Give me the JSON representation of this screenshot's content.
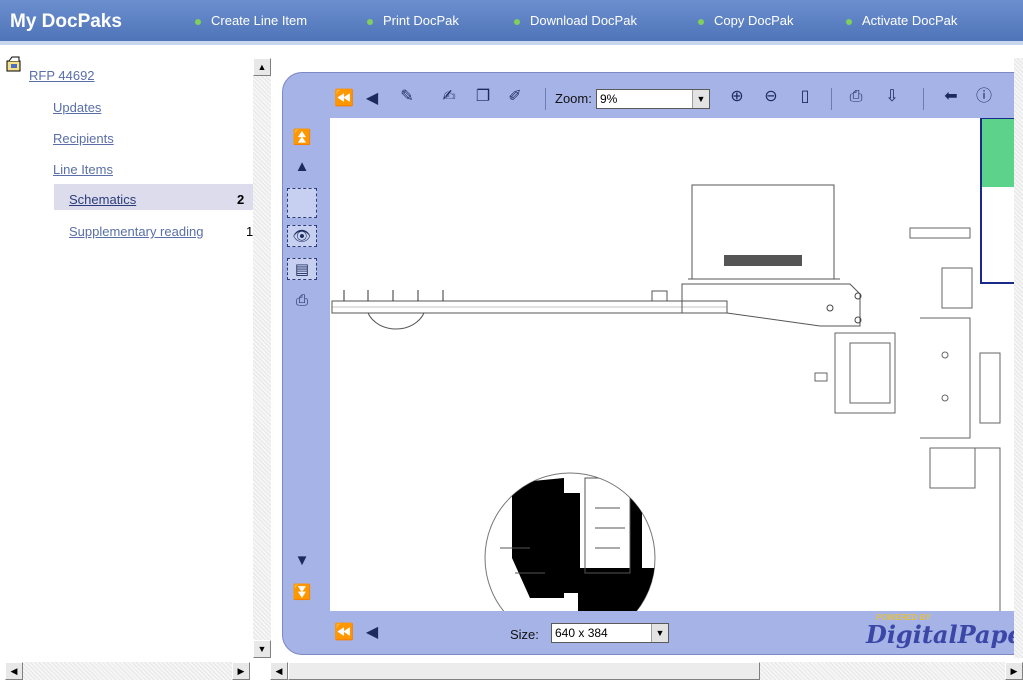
{
  "app": {
    "title": "My DocPaks"
  },
  "nav": [
    {
      "label": "Create Line Item"
    },
    {
      "label": "Print DocPak"
    },
    {
      "label": "Download DocPak"
    },
    {
      "label": "Copy DocPak"
    },
    {
      "label": "Activate DocPak"
    }
  ],
  "tree": {
    "root": "RFP 44692",
    "items": [
      {
        "label": "Updates"
      },
      {
        "label": "Recipients"
      },
      {
        "label": "Line Items"
      }
    ],
    "subitems": [
      {
        "label": "Schematics",
        "count": "2",
        "selected": true
      },
      {
        "label": "Supplementary reading",
        "count": "1"
      }
    ]
  },
  "viewer": {
    "zoom_label": "Zoom:",
    "zoom_value": "9%",
    "size_label": "Size:",
    "size_value": "640 x 384",
    "brand_small": "POWERED BY",
    "brand": "DigitalPaper"
  },
  "colors": {
    "header": "#5a7fc2",
    "viewer_frame": "#a6b3e6",
    "link": "#5a6fa8",
    "selection": "#dcdcec",
    "thumbnail_accent": "#5cd28a"
  },
  "icons": {
    "toolbar": [
      "first-page-icon",
      "prev-page-icon",
      "annotate-icon",
      "stamp-icon",
      "copy-icon",
      "edit-icon",
      "zoom-in-icon",
      "zoom-out-icon",
      "fit-page-icon",
      "print-icon",
      "export-icon",
      "back-icon",
      "info-icon"
    ],
    "side": [
      "first-icon",
      "prev-icon",
      "select-icon",
      "eye-icon",
      "page-icon",
      "print-icon",
      "next-icon",
      "last-icon"
    ]
  }
}
